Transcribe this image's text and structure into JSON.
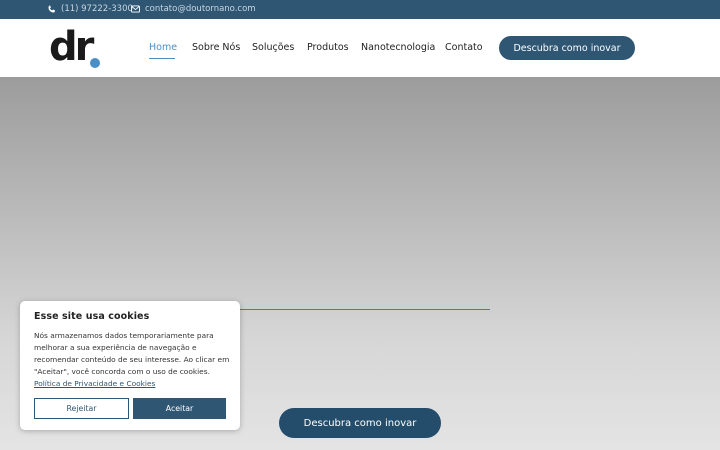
{
  "topbar": {
    "phone": "(11) 97222-3300",
    "email": "contato@doutornano.com",
    "icons": [
      "phone-icon",
      "envelope-icon"
    ]
  },
  "header": {
    "logo_text": "dr",
    "nav": [
      {
        "label": "Home",
        "active": true
      },
      {
        "label": "Sobre Nós",
        "active": false
      },
      {
        "label": "Soluções",
        "active": false
      },
      {
        "label": "Produtos",
        "active": false
      },
      {
        "label": "Nanotecnologia",
        "active": false
      },
      {
        "label": "Contato",
        "active": false
      }
    ],
    "cta_label": "Descubra como inovar"
  },
  "hero": {
    "cta_label": "Descubra como inovar"
  },
  "cookie_banner": {
    "title": "Esse site usa cookies",
    "text": "Nós armazenamos dados temporariamente para melhorar a sua experiência de navegação e recomendar conteúdo de seu interesse. Ao clicar em \"Aceitar\", você concorda com o uso de cookies.",
    "link_text": "Política de Privacidade e Cookies",
    "reject_label": "Rejeitar",
    "accept_label": "Aceitar"
  },
  "colors": {
    "brand": "#2f5774",
    "active_nav": "#4a90c6",
    "logo_dot": "#4a90c6"
  }
}
